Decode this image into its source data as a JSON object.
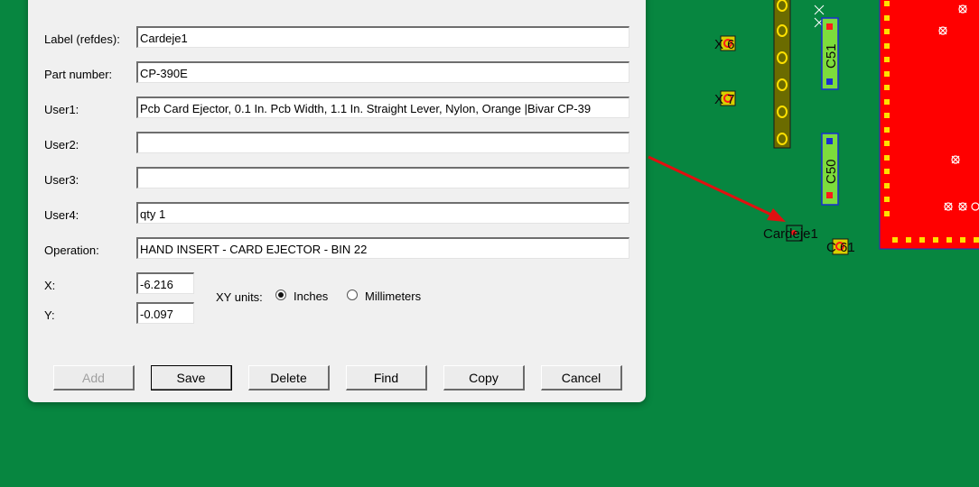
{
  "dialog": {
    "fields": [
      {
        "label": "Label (refdes):",
        "value": "Cardeje1"
      },
      {
        "label": "Part number:",
        "value": "CP-390E"
      },
      {
        "label": "User1:",
        "value": "Pcb Card Ejector, 0.1 In. Pcb Width, 1.1 In. Straight Lever, Nylon, Orange |Bivar CP-39"
      },
      {
        "label": "User2:",
        "value": ""
      },
      {
        "label": "User3:",
        "value": ""
      },
      {
        "label": "User4:",
        "value": "qty 1"
      },
      {
        "label": "Operation:",
        "value": "HAND INSERT - CARD EJECTOR - BIN 22"
      }
    ],
    "x": {
      "label": "X:",
      "value": "-6.216"
    },
    "y": {
      "label": "Y:",
      "value": "-0.097"
    },
    "units": {
      "label": "XY units:",
      "inches": "Inches",
      "millimeters": "Millimeters",
      "selected": "inches"
    },
    "buttons": {
      "add": "Add",
      "save": "Save",
      "delete": "Delete",
      "find": "Find",
      "copy": "Copy",
      "cancel": "Cancel"
    }
  },
  "pcb": {
    "labels": {
      "x6": "X 6",
      "x7": "X 7",
      "c51": "C51",
      "c50": "C50",
      "cardeje": "Cardeje1",
      "c61": "C 61"
    },
    "colors": {
      "board": "#078640",
      "pad": "#d7d000",
      "copper": "#ff0000",
      "arrow": "#e01010",
      "cap_body": "#7ddc3c",
      "connector": "#6b6b00"
    }
  }
}
